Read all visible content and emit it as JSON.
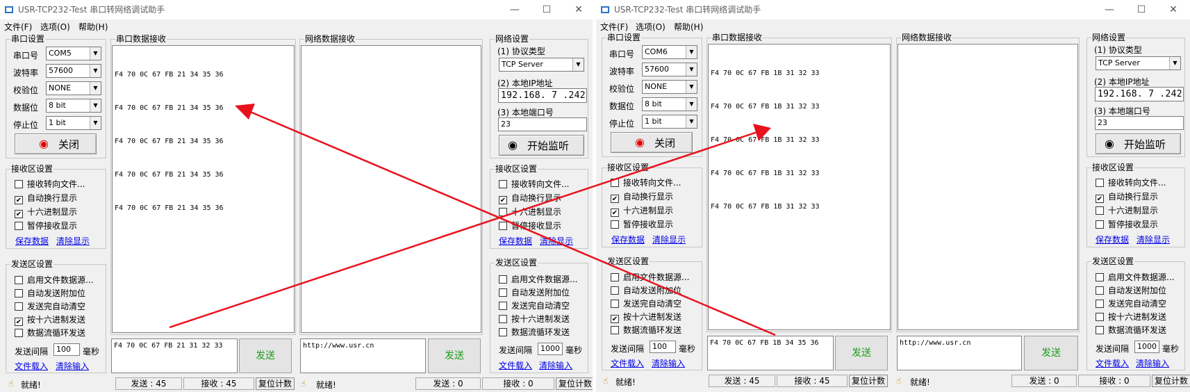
{
  "windows": [
    {
      "title": "USR-TCP232-Test 串口转网络调试助手",
      "menu": [
        "文件(F)",
        "选项(O)",
        "帮助(H)"
      ],
      "serial_settings": {
        "title": "串口设置",
        "port_label": "串口号",
        "port_value": "COM5",
        "baud_label": "波特率",
        "baud_value": "57600",
        "parity_label": "校验位",
        "parity_value": "NONE",
        "databits_label": "数据位",
        "databits_value": "8 bit",
        "stopbits_label": "停止位",
        "stopbits_value": "1 bit",
        "close_button": "关闭"
      },
      "serial_recv_settings": {
        "title": "接收区设置",
        "opt1": "接收转向文件...",
        "opt1_checked": false,
        "opt2": "自动换行显示",
        "opt2_checked": true,
        "opt3": "十六进制显示",
        "opt3_checked": true,
        "opt4": "暂停接收显示",
        "opt4_checked": false,
        "save_link": "保存数据",
        "clear_link": "清除显示"
      },
      "serial_send_settings": {
        "title": "发送区设置",
        "opt1": "启用文件数据源...",
        "opt1_checked": false,
        "opt2": "自动发送附加位",
        "opt2_checked": false,
        "opt3": "发送完自动清空",
        "opt3_checked": false,
        "opt4": "按十六进制发送",
        "opt4_checked": true,
        "opt5": "数据流循环发送",
        "opt5_checked": false,
        "interval_label": "发送间隔",
        "interval_value": "100",
        "interval_unit": "毫秒",
        "load_link": "文件载入",
        "clear_link": "清除输入"
      },
      "serial_recv": {
        "title": "串口数据接收",
        "lines": [
          "F4 70 0C 67 FB 21 34 35 36",
          "F4 70 0C 67 FB 21 34 35 36",
          "F4 70 0C 67 FB 21 34 35 36",
          "F4 70 0C 67 FB 21 34 35 36",
          "F4 70 0C 67 FB 21 34 35 36"
        ]
      },
      "serial_send": {
        "input": "F4 70 0C 67 FB 21 31 32 33",
        "button": "发送"
      },
      "net_recv": {
        "title": "网络数据接收"
      },
      "net_send": {
        "input": "http://www.usr.cn",
        "button": "发送"
      },
      "net_settings": {
        "title": "网络设置",
        "protocol_label": "(1) 协议类型",
        "protocol_value": "TCP Server",
        "ip_label": "(2) 本地IP地址",
        "ip_value": "192.168. 7 .242",
        "port_label": "(3) 本地端口号",
        "port_value": "23",
        "listen_button": "开始监听"
      },
      "net_recv_settings": {
        "title": "接收区设置",
        "opt1": "接收转向文件...",
        "opt1_checked": false,
        "opt2": "自动换行显示",
        "opt2_checked": true,
        "opt3": "十六进制显示",
        "opt3_checked": false,
        "opt4": "暂停接收显示",
        "opt4_checked": false,
        "save_link": "保存数据",
        "clear_link": "清除显示"
      },
      "net_send_settings": {
        "title": "发送区设置",
        "opt1": "启用文件数据源...",
        "opt1_checked": false,
        "opt2": "自动发送附加位",
        "opt2_checked": false,
        "opt3": "发送完自动清空",
        "opt3_checked": false,
        "opt4": "按十六进制发送",
        "opt4_checked": false,
        "opt5": "数据流循环发送",
        "opt5_checked": false,
        "interval_label": "发送间隔",
        "interval_value": "1000",
        "interval_unit": "毫秒",
        "load_link": "文件载入",
        "clear_link": "清除输入"
      },
      "status": {
        "serial_state": "就绪!",
        "serial_sent": "发送 : 45",
        "serial_recv": "接收 : 45",
        "serial_reset": "复位计数",
        "net_state": "就绪!",
        "net_sent": "发送 : 0",
        "net_recv": "接收 : 0",
        "net_reset": "复位计数"
      }
    },
    {
      "title": "USR-TCP232-Test 串口转网络调试助手",
      "menu": [
        "文件(F)",
        "选项(O)",
        "帮助(H)"
      ],
      "serial_settings": {
        "title": "串口设置",
        "port_label": "串口号",
        "port_value": "COM6",
        "baud_label": "波特率",
        "baud_value": "57600",
        "parity_label": "校验位",
        "parity_value": "NONE",
        "databits_label": "数据位",
        "databits_value": "8 bit",
        "stopbits_label": "停止位",
        "stopbits_value": "1 bit",
        "close_button": "关闭"
      },
      "serial_recv_settings": {
        "title": "接收区设置",
        "opt1": "接收转向文件...",
        "opt1_checked": false,
        "opt2": "自动换行显示",
        "opt2_checked": true,
        "opt3": "十六进制显示",
        "opt3_checked": true,
        "opt4": "暂停接收显示",
        "opt4_checked": false,
        "save_link": "保存数据",
        "clear_link": "清除显示"
      },
      "serial_send_settings": {
        "title": "发送区设置",
        "opt1": "启用文件数据源...",
        "opt1_checked": false,
        "opt2": "自动发送附加位",
        "opt2_checked": false,
        "opt3": "发送完自动清空",
        "opt3_checked": false,
        "opt4": "按十六进制发送",
        "opt4_checked": true,
        "opt5": "数据流循环发送",
        "opt5_checked": false,
        "interval_label": "发送间隔",
        "interval_value": "100",
        "interval_unit": "毫秒",
        "load_link": "文件载入",
        "clear_link": "清除输入"
      },
      "serial_recv": {
        "title": "串口数据接收",
        "lines": [
          "F4 70 0C 67 FB 1B 31 32 33",
          "F4 70 0C 67 FB 1B 31 32 33",
          "F4 70 0C 67 FB 1B 31 32 33",
          "F4 70 0C 67 FB 1B 31 32 33",
          "F4 70 0C 67 FB 1B 31 32 33"
        ]
      },
      "serial_send": {
        "input": "F4 70 0C 67 FB 1B 34 35 36",
        "button": "发送"
      },
      "net_recv": {
        "title": "网络数据接收"
      },
      "net_send": {
        "input": "http://www.usr.cn",
        "button": "发送"
      },
      "net_settings": {
        "title": "网络设置",
        "protocol_label": "(1) 协议类型",
        "protocol_value": "TCP Server",
        "ip_label": "(2) 本地IP地址",
        "ip_value": "192.168. 7 .242",
        "port_label": "(3) 本地端口号",
        "port_value": "23",
        "listen_button": "开始监听"
      },
      "net_recv_settings": {
        "title": "接收区设置",
        "opt1": "接收转向文件...",
        "opt1_checked": false,
        "opt2": "自动换行显示",
        "opt2_checked": true,
        "opt3": "十六进制显示",
        "opt3_checked": false,
        "opt4": "暂停接收显示",
        "opt4_checked": false,
        "save_link": "保存数据",
        "clear_link": "清除显示"
      },
      "net_send_settings": {
        "title": "发送区设置",
        "opt1": "启用文件数据源...",
        "opt1_checked": false,
        "opt2": "自动发送附加位",
        "opt2_checked": false,
        "opt3": "发送完自动清空",
        "opt3_checked": false,
        "opt4": "按十六进制发送",
        "opt4_checked": false,
        "opt5": "数据流循环发送",
        "opt5_checked": false,
        "interval_label": "发送间隔",
        "interval_value": "1000",
        "interval_unit": "毫秒",
        "load_link": "文件载入",
        "clear_link": "清除输入"
      },
      "status": {
        "serial_state": "就绪!",
        "serial_sent": "发送 : 45",
        "serial_recv": "接收 : 45",
        "serial_reset": "复位计数",
        "net_state": "就绪!",
        "net_sent": "发送 : 0",
        "net_recv": "接收 : 0",
        "net_reset": "复位计数"
      }
    }
  ],
  "colors": {
    "annotation_arrow": "#e8121d",
    "link": "#0000e6",
    "send_text": "#1a9e1a",
    "close_icon": "#e00000"
  },
  "icons": {
    "close_button": "red-record-icon",
    "listen_button": "black-record-icon",
    "status": "hand-icon"
  }
}
